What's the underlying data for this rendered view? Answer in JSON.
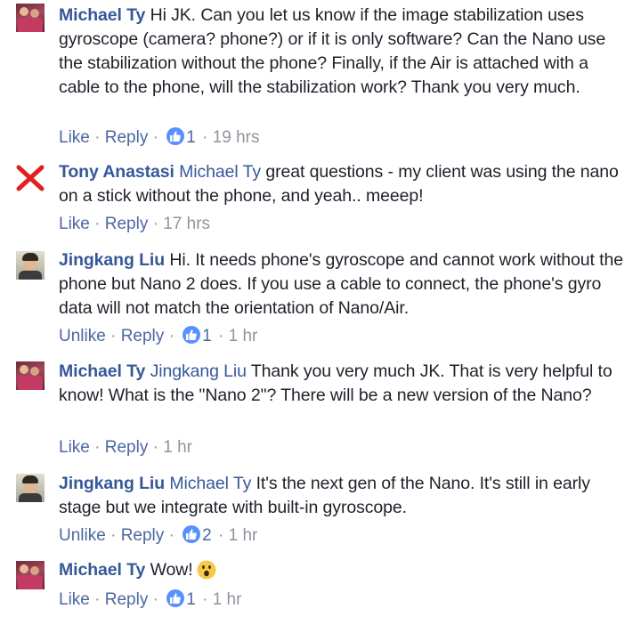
{
  "comments": [
    {
      "author": "Michael Ty",
      "mention": "",
      "text": "Hi JK. Can you let us know if the image stabilization uses gyroscope (camera? phone?) or if it is only software? Can the Nano use the stabilization without the phone? Finally, if the Air is attached with a cable to the phone, will the stabilization work? Thank you very much.",
      "like_label": "Like",
      "reply_label": "Reply",
      "reactions": "1",
      "time": "19 hrs"
    },
    {
      "author": "Tony Anastasi",
      "mention": "Michael Ty",
      "text": "great questions - my client was using the nano on a stick without the phone, and yeah.. meeep!",
      "like_label": "Like",
      "reply_label": "Reply",
      "reactions": "",
      "time": "17 hrs"
    },
    {
      "author": "Jingkang Liu",
      "mention": "",
      "text": "Hi. It needs phone's gyroscope and cannot work without the phone but Nano 2 does. If you use a cable to connect, the phone's gyro data will not match the orientation of Nano/Air.",
      "like_label": "Unlike",
      "reply_label": "Reply",
      "reactions": "1",
      "time": "1 hr"
    },
    {
      "author": "Michael Ty",
      "mention": "Jingkang Liu",
      "text": "Thank you very much JK. That is very helpful to know! What is the \"Nano 2\"? There will be a new version of the Nano?",
      "like_label": "Like",
      "reply_label": "Reply",
      "reactions": "",
      "time": "1 hr"
    },
    {
      "author": "Jingkang Liu",
      "mention": "Michael Ty",
      "text": "It's the next gen of the Nano. It's still in early stage but we integrate with built-in gyroscope.",
      "like_label": "Unlike",
      "reply_label": "Reply",
      "reactions": "2",
      "time": "1 hr"
    },
    {
      "author": "Michael Ty",
      "mention": "",
      "text": "Wow!",
      "like_label": "Like",
      "reply_label": "Reply",
      "reactions": "1",
      "time": "1 hr"
    }
  ],
  "separator": "·",
  "colors": {
    "link_blue": "#365899",
    "meta_gray": "#90949c",
    "like_badge": "#5890ff",
    "text": "#1d2129"
  }
}
